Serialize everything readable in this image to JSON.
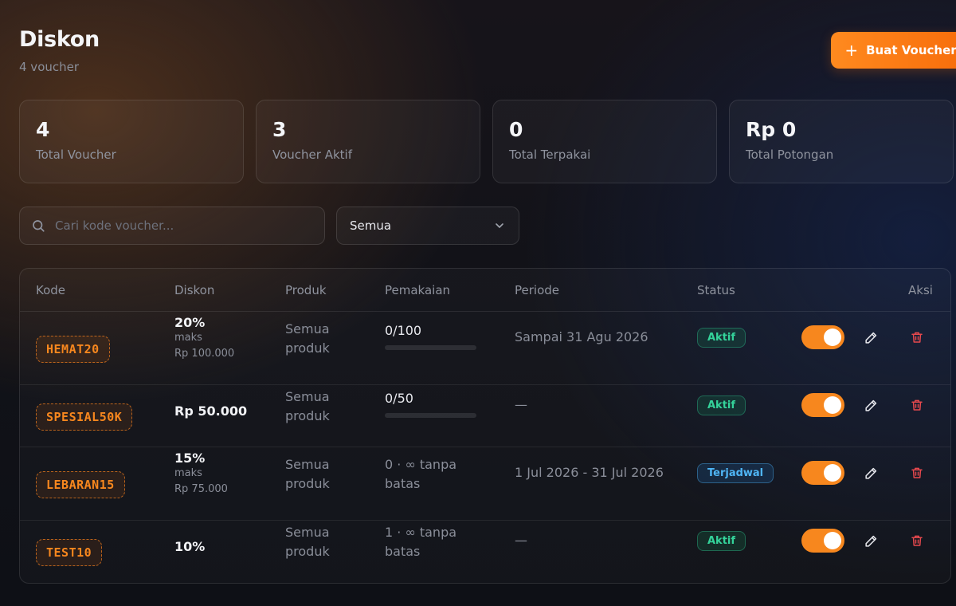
{
  "header": {
    "title": "Diskon",
    "subtitle": "4 voucher",
    "create_label": "Buat Voucher"
  },
  "stats": [
    {
      "value": "4",
      "label": "Total Voucher"
    },
    {
      "value": "3",
      "label": "Voucher Aktif"
    },
    {
      "value": "0",
      "label": "Total Terpakai"
    },
    {
      "value": "Rp 0",
      "label": "Total Potongan"
    }
  ],
  "filters": {
    "search_placeholder": "Cari kode voucher...",
    "status_selected": "Semua"
  },
  "table": {
    "columns": {
      "code": "Kode",
      "discount": "Diskon",
      "product": "Produk",
      "usage": "Pemakaian",
      "period": "Periode",
      "status": "Status",
      "actions": "Aksi"
    },
    "rows": [
      {
        "code": "HEMAT20",
        "discount": "20%",
        "max_label": "maks",
        "max_value": "Rp 100.000",
        "product_line1": "Semua",
        "product_line2": "produk",
        "usage_line1": "0/100",
        "usage_line2": "",
        "usage_fraction": 0,
        "period": "Sampai 31 Agu 2026",
        "status": "Aktif",
        "status_type": "active",
        "enabled": true
      },
      {
        "code": "SPESIAL50K",
        "discount": "Rp 50.000",
        "max_label": "",
        "max_value": "",
        "product_line1": "Semua",
        "product_line2": "produk",
        "usage_line1": "0/50",
        "usage_line2": "",
        "usage_fraction": 0,
        "period": "—",
        "status": "Aktif",
        "status_type": "active",
        "enabled": true
      },
      {
        "code": "LEBARAN15",
        "discount": "15%",
        "max_label": "maks",
        "max_value": "Rp 75.000",
        "product_line1": "Semua",
        "product_line2": "produk",
        "usage_line1": "0 · ∞ tanpa",
        "usage_line2": "batas",
        "usage_fraction": null,
        "period": "1 Jul 2026 - 31 Jul 2026",
        "status": "Terjadwal",
        "status_type": "scheduled",
        "enabled": true
      },
      {
        "code": "TEST10",
        "discount": "10%",
        "max_label": "",
        "max_value": "",
        "product_line1": "Semua",
        "product_line2": "produk",
        "usage_line1": "1 · ∞ tanpa",
        "usage_line2": "batas",
        "usage_fraction": null,
        "period": "—",
        "status": "Aktif",
        "status_type": "active",
        "enabled": true
      }
    ]
  },
  "icons": {
    "search": "search-icon",
    "chevron": "chevron-down-icon",
    "plus": "plus-icon",
    "edit": "pencil-icon",
    "delete": "trash-icon"
  },
  "colors": {
    "accent": "#f7871e",
    "active": "#34d39a",
    "scheduled": "#4fb5f5",
    "danger": "#e5484d"
  }
}
